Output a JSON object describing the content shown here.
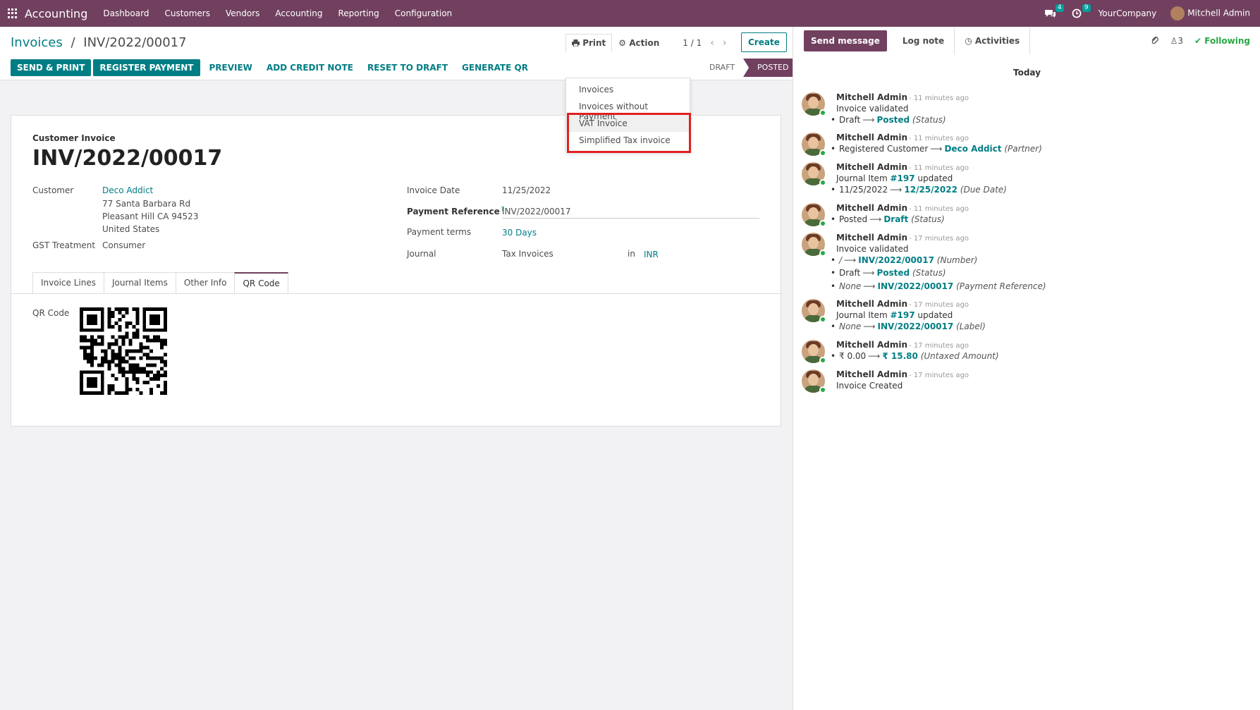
{
  "navbar": {
    "app_name": "Accounting",
    "menu": [
      "Dashboard",
      "Customers",
      "Vendors",
      "Accounting",
      "Reporting",
      "Configuration"
    ],
    "messages_badge": "4",
    "activities_badge": "9",
    "company": "YourCompany",
    "user": "Mitchell Admin"
  },
  "breadcrumb": {
    "parent": "Invoices",
    "separator": "/",
    "current": "INV/2022/00017"
  },
  "toolbar": {
    "print_label": "Print",
    "action_label": "Action",
    "pager": "1 / 1",
    "prev_icon": "chevron-left-icon",
    "next_icon": "chevron-right-icon",
    "create_label": "Create"
  },
  "buttons": {
    "send_print": "SEND & PRINT",
    "register_payment": "REGISTER PAYMENT",
    "preview": "PREVIEW",
    "add_credit_note": "ADD CREDIT NOTE",
    "reset_to_draft": "RESET TO DRAFT",
    "generate_qr": "GENERATE QR"
  },
  "status": {
    "draft": "DRAFT",
    "posted": "POSTED"
  },
  "print_menu": [
    "Invoices",
    "Invoices without Payment",
    "VAT Invoice",
    "Simplified Tax invoice"
  ],
  "form": {
    "type_label": "Customer Invoice",
    "title": "INV/2022/00017",
    "customer_label": "Customer",
    "customer_name": "Deco Addict",
    "address_1": "77 Santa Barbara Rd",
    "address_2": "Pleasant Hill CA 94523",
    "address_3": "United States",
    "gst_label": "GST Treatment",
    "gst_value": "Consumer",
    "invoice_date_label": "Invoice Date",
    "invoice_date": "11/25/2022",
    "payment_ref_label": "Payment Reference",
    "payment_ref_help": "?",
    "payment_ref": "INV/2022/00017",
    "payment_terms_label": "Payment terms",
    "payment_terms": "30 Days",
    "journal_label": "Journal",
    "journal": "Tax Invoices",
    "journal_in": "in",
    "currency": "INR",
    "qr_label": "QR Code"
  },
  "tabs": [
    "Invoice Lines",
    "Journal Items",
    "Other Info",
    "QR Code"
  ],
  "chatter": {
    "send_message": "Send message",
    "log_note": "Log note",
    "activities": "Activities",
    "followers": "3",
    "following": "Following",
    "today": "Today",
    "messages": [
      {
        "author": "Mitchell Admin",
        "time": "- 11 minutes ago",
        "text": "Invoice validated"
      },
      {
        "author": "Mitchell Admin",
        "time": "- 11 minutes ago"
      },
      {
        "author": "Mitchell Admin",
        "time": "- 11 minutes ago",
        "text_pre": "Journal Item ",
        "text_link": "#197",
        "text_post": " updated"
      },
      {
        "author": "Mitchell Admin",
        "time": "- 11 minutes ago"
      },
      {
        "author": "Mitchell Admin",
        "time": "- 17 minutes ago",
        "text": "Invoice validated"
      },
      {
        "author": "Mitchell Admin",
        "time": "- 17 minutes ago",
        "text_pre": "Journal Item ",
        "text_link": "#197",
        "text_post": " updated"
      },
      {
        "author": "Mitchell Admin",
        "time": "- 17 minutes ago"
      },
      {
        "author": "Mitchell Admin",
        "time": "- 17 minutes ago",
        "text": "Invoice Created"
      }
    ],
    "tracking": {
      "m1": {
        "old": "Draft",
        "new": "Posted",
        "field": "(Status)"
      },
      "m2": {
        "old": "Registered Customer",
        "new": "Deco Addict",
        "field": "(Partner)"
      },
      "m3": {
        "old": "11/25/2022",
        "new": "12/25/2022",
        "field": "(Due Date)"
      },
      "m4": {
        "old": "Posted",
        "new": "Draft",
        "field": "(Status)"
      },
      "m5a": {
        "old": "/",
        "new": "INV/2022/00017",
        "field": "(Number)"
      },
      "m5b": {
        "old": "Draft",
        "new": "Posted",
        "field": "(Status)"
      },
      "m5c": {
        "old": "None",
        "new": "INV/2022/00017",
        "field": "(Payment Reference)"
      },
      "m6": {
        "old": "None",
        "new": "INV/2022/00017",
        "field": "(Label)"
      },
      "m7": {
        "old": "₹ 0.00",
        "new": "₹ 15.80",
        "field": "(Untaxed Amount)"
      }
    }
  },
  "colors": {
    "brand": "#71405f",
    "accent": "#017e84",
    "highlight_box": "#e02020"
  }
}
